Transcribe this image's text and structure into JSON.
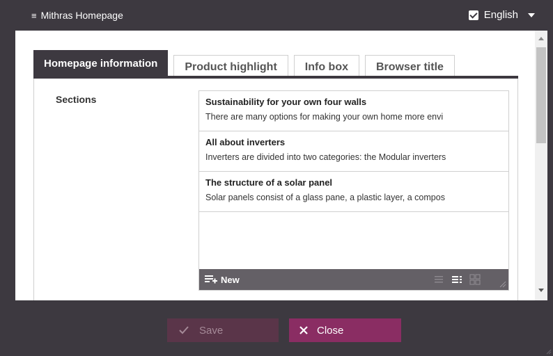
{
  "window": {
    "title": "Mithras Homepage",
    "language": "English",
    "language_checked": true
  },
  "tabs": [
    {
      "label": "Homepage information",
      "active": true
    },
    {
      "label": "Product highlight",
      "active": false
    },
    {
      "label": "Info box",
      "active": false
    },
    {
      "label": "Browser title",
      "active": false
    }
  ],
  "form": {
    "sections_label": "Sections",
    "sections": [
      {
        "title": "Sustainability for your own four walls",
        "text": "There are many options for making your own home more envi"
      },
      {
        "title": "All about inverters",
        "text": "Inverters are divided into two categories: the Modular inverters"
      },
      {
        "title": "The structure of a solar panel",
        "text": "Solar panels consist of a glass pane, a plastic layer, a compos"
      }
    ],
    "new_label": "New"
  },
  "footer": {
    "save_label": "Save",
    "close_label": "Close"
  },
  "colors": {
    "frame": "#3d3940",
    "accent": "#8a2d63",
    "toolbar": "#646066"
  },
  "icons": [
    "menu-icon",
    "checkbox-icon",
    "dropdown-caret-icon",
    "new-item-icon",
    "list-view-icon",
    "detail-view-icon",
    "grid-view-icon",
    "resize-grip-icon",
    "check-icon",
    "close-x-icon"
  ]
}
